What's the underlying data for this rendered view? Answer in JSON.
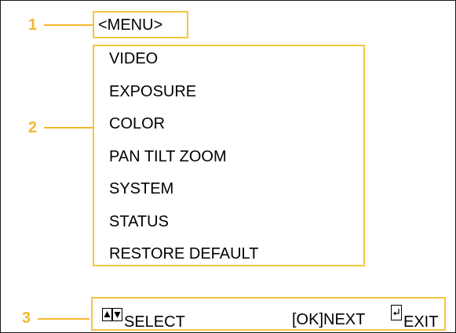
{
  "callouts": [
    "1",
    "2",
    "3"
  ],
  "menu": {
    "title": "<MENU>",
    "items": [
      {
        "label": "VIDEO"
      },
      {
        "label": "EXPOSURE"
      },
      {
        "label": "COLOR"
      },
      {
        "label": "PAN TILT ZOOM"
      },
      {
        "label": "SYSTEM"
      },
      {
        "label": "STATUS"
      },
      {
        "label": "RESTORE DEFAULT"
      }
    ]
  },
  "bottom_bar": {
    "select_icon": "up-down-arrows-icon",
    "select_label": "SELECT",
    "next_label": "[OK]NEXT",
    "exit_icon": "return-icon",
    "exit_label": "EXIT"
  },
  "colors": {
    "callout": "#f5b82e",
    "box_border": "#f5c542",
    "text": "#000000",
    "background": "#ffffff"
  }
}
